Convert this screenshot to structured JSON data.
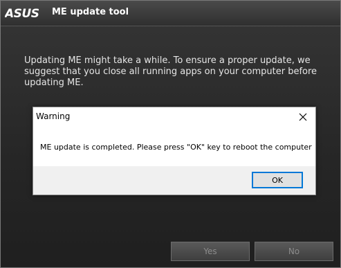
{
  "app": {
    "logo_text": "ASUS",
    "title": "ME update tool",
    "info_text": "Updating ME might take a while. To ensure a proper update, we suggest that you close all running apps on your computer before updating ME.",
    "yes_label": "Yes",
    "no_label": "No"
  },
  "dialog": {
    "title": "Warning",
    "message": "ME update is completed. Please press \"OK\" key to reboot the computer",
    "ok_label": "OK"
  },
  "icons": {
    "close": "close-icon"
  },
  "colors": {
    "background": "#2b2b2b",
    "accent": "#0078d7"
  }
}
